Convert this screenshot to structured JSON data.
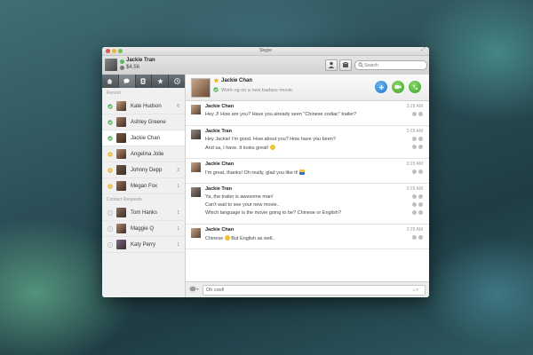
{
  "window": {
    "title": "Skype"
  },
  "me": {
    "name": "Jackie Tran",
    "credit": "$4.56"
  },
  "search": {
    "placeholder": "Search"
  },
  "sidebar": {
    "tabs": [
      {
        "icon": "home-icon"
      },
      {
        "icon": "chat-icon"
      },
      {
        "icon": "contacts-book-icon"
      },
      {
        "icon": "star-icon"
      },
      {
        "icon": "clock-icon"
      }
    ],
    "recent_heading": "Recent",
    "recent": [
      {
        "name": "Kate Hudson",
        "count": "6",
        "status": "online",
        "avatar_color": "#c9a27e"
      },
      {
        "name": "Ashley Greene",
        "count": "",
        "status": "online",
        "avatar_color": "#a47a60"
      },
      {
        "name": "Jackie Chan",
        "count": "",
        "status": "online",
        "avatar_color": "#7a5a44",
        "selected": true
      },
      {
        "name": "Angelina Jolie",
        "count": "",
        "status": "away",
        "avatar_color": "#b88a6a"
      },
      {
        "name": "Johnny Depp",
        "count": "2",
        "status": "away",
        "avatar_color": "#6f5a4a"
      },
      {
        "name": "Megan Fox",
        "count": "1",
        "status": "away",
        "avatar_color": "#9a6f55"
      }
    ],
    "requests_heading": "Contact Requests",
    "requests": [
      {
        "name": "Tom Hanks",
        "count": "1",
        "avatar_color": "#8a7260"
      },
      {
        "name": "Maggie Q",
        "count": "1",
        "avatar_color": "#b08a70"
      },
      {
        "name": "Katy Perry",
        "count": "1",
        "avatar_color": "#7d6a8c"
      }
    ]
  },
  "chat": {
    "contact_name": "Jackie Chan",
    "mood": "Work-ng on a new badass movie.",
    "messages": [
      {
        "author": "Jackie Chan",
        "time": "3:29 AM",
        "lines": [
          "Hey J! How are you? Have you already seen \"Chinese zodiac\" trailer?"
        ]
      },
      {
        "author": "Jackie Tran",
        "time": "3:29 AM",
        "lines": [
          "Hey Jackie! I'm good. How about you? How have you been?",
          "And sa, I have. It looks great!"
        ]
      },
      {
        "author": "Jackie Chan",
        "time": "3:29 AM",
        "lines": [
          "I'm great, thanks! Oh really, glad you like it!"
        ]
      },
      {
        "author": "Jackie Tran",
        "time": "3:29 AM",
        "lines": [
          "Ya, the trailer is awesome man!",
          "Can't wait to see your new movie..",
          "Which language is the movie going to be? Chinese or English?"
        ]
      },
      {
        "author": "Jackie Chan",
        "time": "3:29 AM",
        "lines": [
          "Chinese",
          "But English as well.."
        ]
      }
    ]
  },
  "compose": {
    "value": "Oh cool!"
  },
  "colors": {
    "accent_blue": "#1f76c9",
    "accent_green": "#3a9e2a",
    "status_online": "#5cb85c",
    "status_away": "#e9b73e"
  }
}
